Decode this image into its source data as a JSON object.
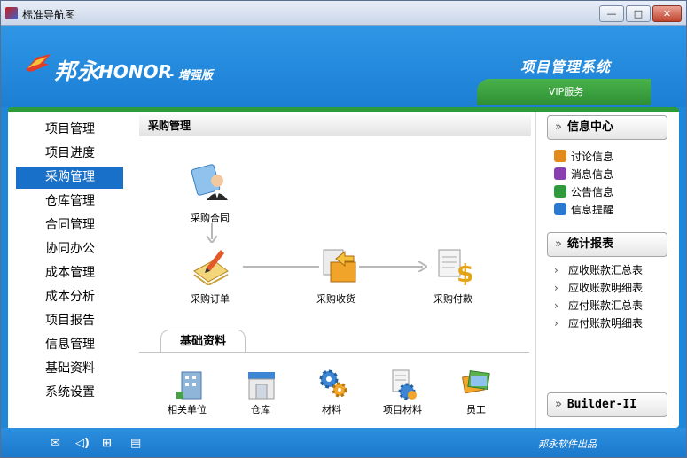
{
  "window": {
    "title": "标准导航图",
    "min": "—",
    "max": "□",
    "close": "✕"
  },
  "header": {
    "logo_cn": "邦永",
    "logo_en": "HONOR",
    "logo_edition": "- 增强版",
    "system_title": "项目管理系统",
    "vip_tab": "VIP服务"
  },
  "nav": {
    "items": [
      {
        "label": "项目管理"
      },
      {
        "label": "项目进度"
      },
      {
        "label": "采购管理",
        "active": true
      },
      {
        "label": "仓库管理"
      },
      {
        "label": "合同管理"
      },
      {
        "label": "协同办公"
      },
      {
        "label": "成本管理"
      },
      {
        "label": "成本分析"
      },
      {
        "label": "项目报告"
      },
      {
        "label": "信息管理"
      },
      {
        "label": "基础资料"
      },
      {
        "label": "系统设置"
      }
    ]
  },
  "main": {
    "section_title": "采购管理",
    "flow": {
      "contract": "采购合同",
      "order": "采购订单",
      "receive": "采购收货",
      "pay": "采购付款"
    },
    "base_tab": "基础资料",
    "base_items": [
      {
        "label": "相关单位",
        "icon": "building-icon"
      },
      {
        "label": "仓库",
        "icon": "warehouse-icon"
      },
      {
        "label": "材料",
        "icon": "gears-icon"
      },
      {
        "label": "项目材料",
        "icon": "project-material-icon"
      },
      {
        "label": "员工",
        "icon": "staff-photos-icon"
      }
    ]
  },
  "right": {
    "info_center": {
      "title": "信息中心",
      "items": [
        {
          "label": "讨论信息",
          "color": "#e38b1a"
        },
        {
          "label": "消息信息",
          "color": "#8a3fb0"
        },
        {
          "label": "公告信息",
          "color": "#2f9a3a"
        },
        {
          "label": "信息提醒",
          "color": "#2b78d0"
        }
      ]
    },
    "reports": {
      "title": "统计报表",
      "items": [
        {
          "label": "应收账款汇总表"
        },
        {
          "label": "应收账款明细表"
        },
        {
          "label": "应付账款汇总表"
        },
        {
          "label": "应付账款明细表"
        }
      ]
    },
    "builder": {
      "title": "Builder-II"
    },
    "chevron": "»"
  },
  "status": {
    "vendor": "邦永软件出品"
  },
  "colors": {
    "accent_blue": "#1970c8",
    "accent_green": "#2e9b3a",
    "header_blue": "#1f87d8"
  }
}
